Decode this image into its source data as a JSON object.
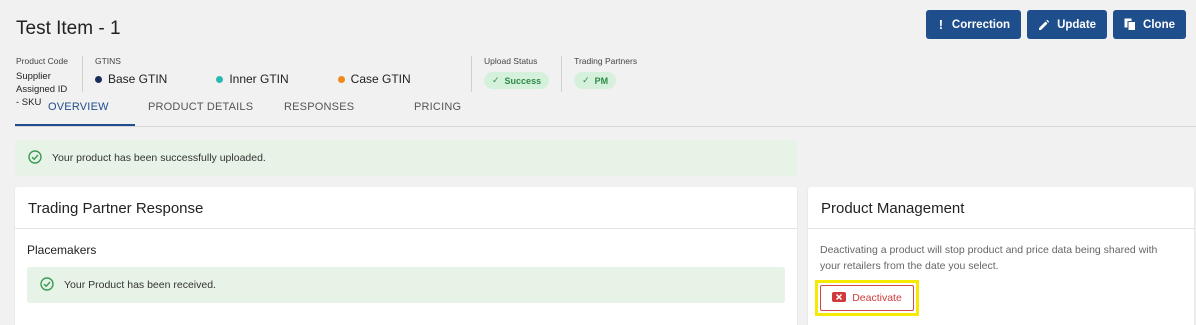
{
  "header": {
    "title": "Test Item - 1"
  },
  "actions": [
    {
      "label": "Correction",
      "icon": "exclamation-icon"
    },
    {
      "label": "Update",
      "icon": "pencil-icon"
    },
    {
      "label": "Clone",
      "icon": "copy-icon"
    }
  ],
  "meta": {
    "product_code_label": "Product Code",
    "product_code_value": "Supplier Assigned ID - SKU",
    "gtins_label": "GTINS",
    "gtins": [
      {
        "label": "Base GTIN",
        "color": "#1b2d5c"
      },
      {
        "label": "Inner GTIN",
        "color": "#2bb8b0"
      },
      {
        "label": "Case GTIN",
        "color": "#f08a1c"
      }
    ],
    "upload_status_label": "Upload Status",
    "upload_status_value": "Success",
    "trading_partners_label": "Trading Partners",
    "trading_partners_value": "PM"
  },
  "tabs": [
    "OVERVIEW",
    "PRODUCT DETAILS",
    "RESPONSES",
    "PRICING"
  ],
  "active_tab": "OVERVIEW",
  "alert": {
    "text": "Your product has been successfully uploaded."
  },
  "trading_partner_response": {
    "title": "Trading Partner Response",
    "partner_name": "Placemakers",
    "message": "Your Product has been received."
  },
  "product_management": {
    "title": "Product Management",
    "description": "Deactivating a product will stop product and price data being shared with your retailers from the date you select.",
    "deactivate_label": "Deactivate"
  },
  "colors": {
    "primary": "#1f4e8c",
    "success_bg": "#e7f3e7",
    "success": "#2f8a48",
    "danger": "#d03a3a",
    "highlight": "#f5ea00"
  }
}
